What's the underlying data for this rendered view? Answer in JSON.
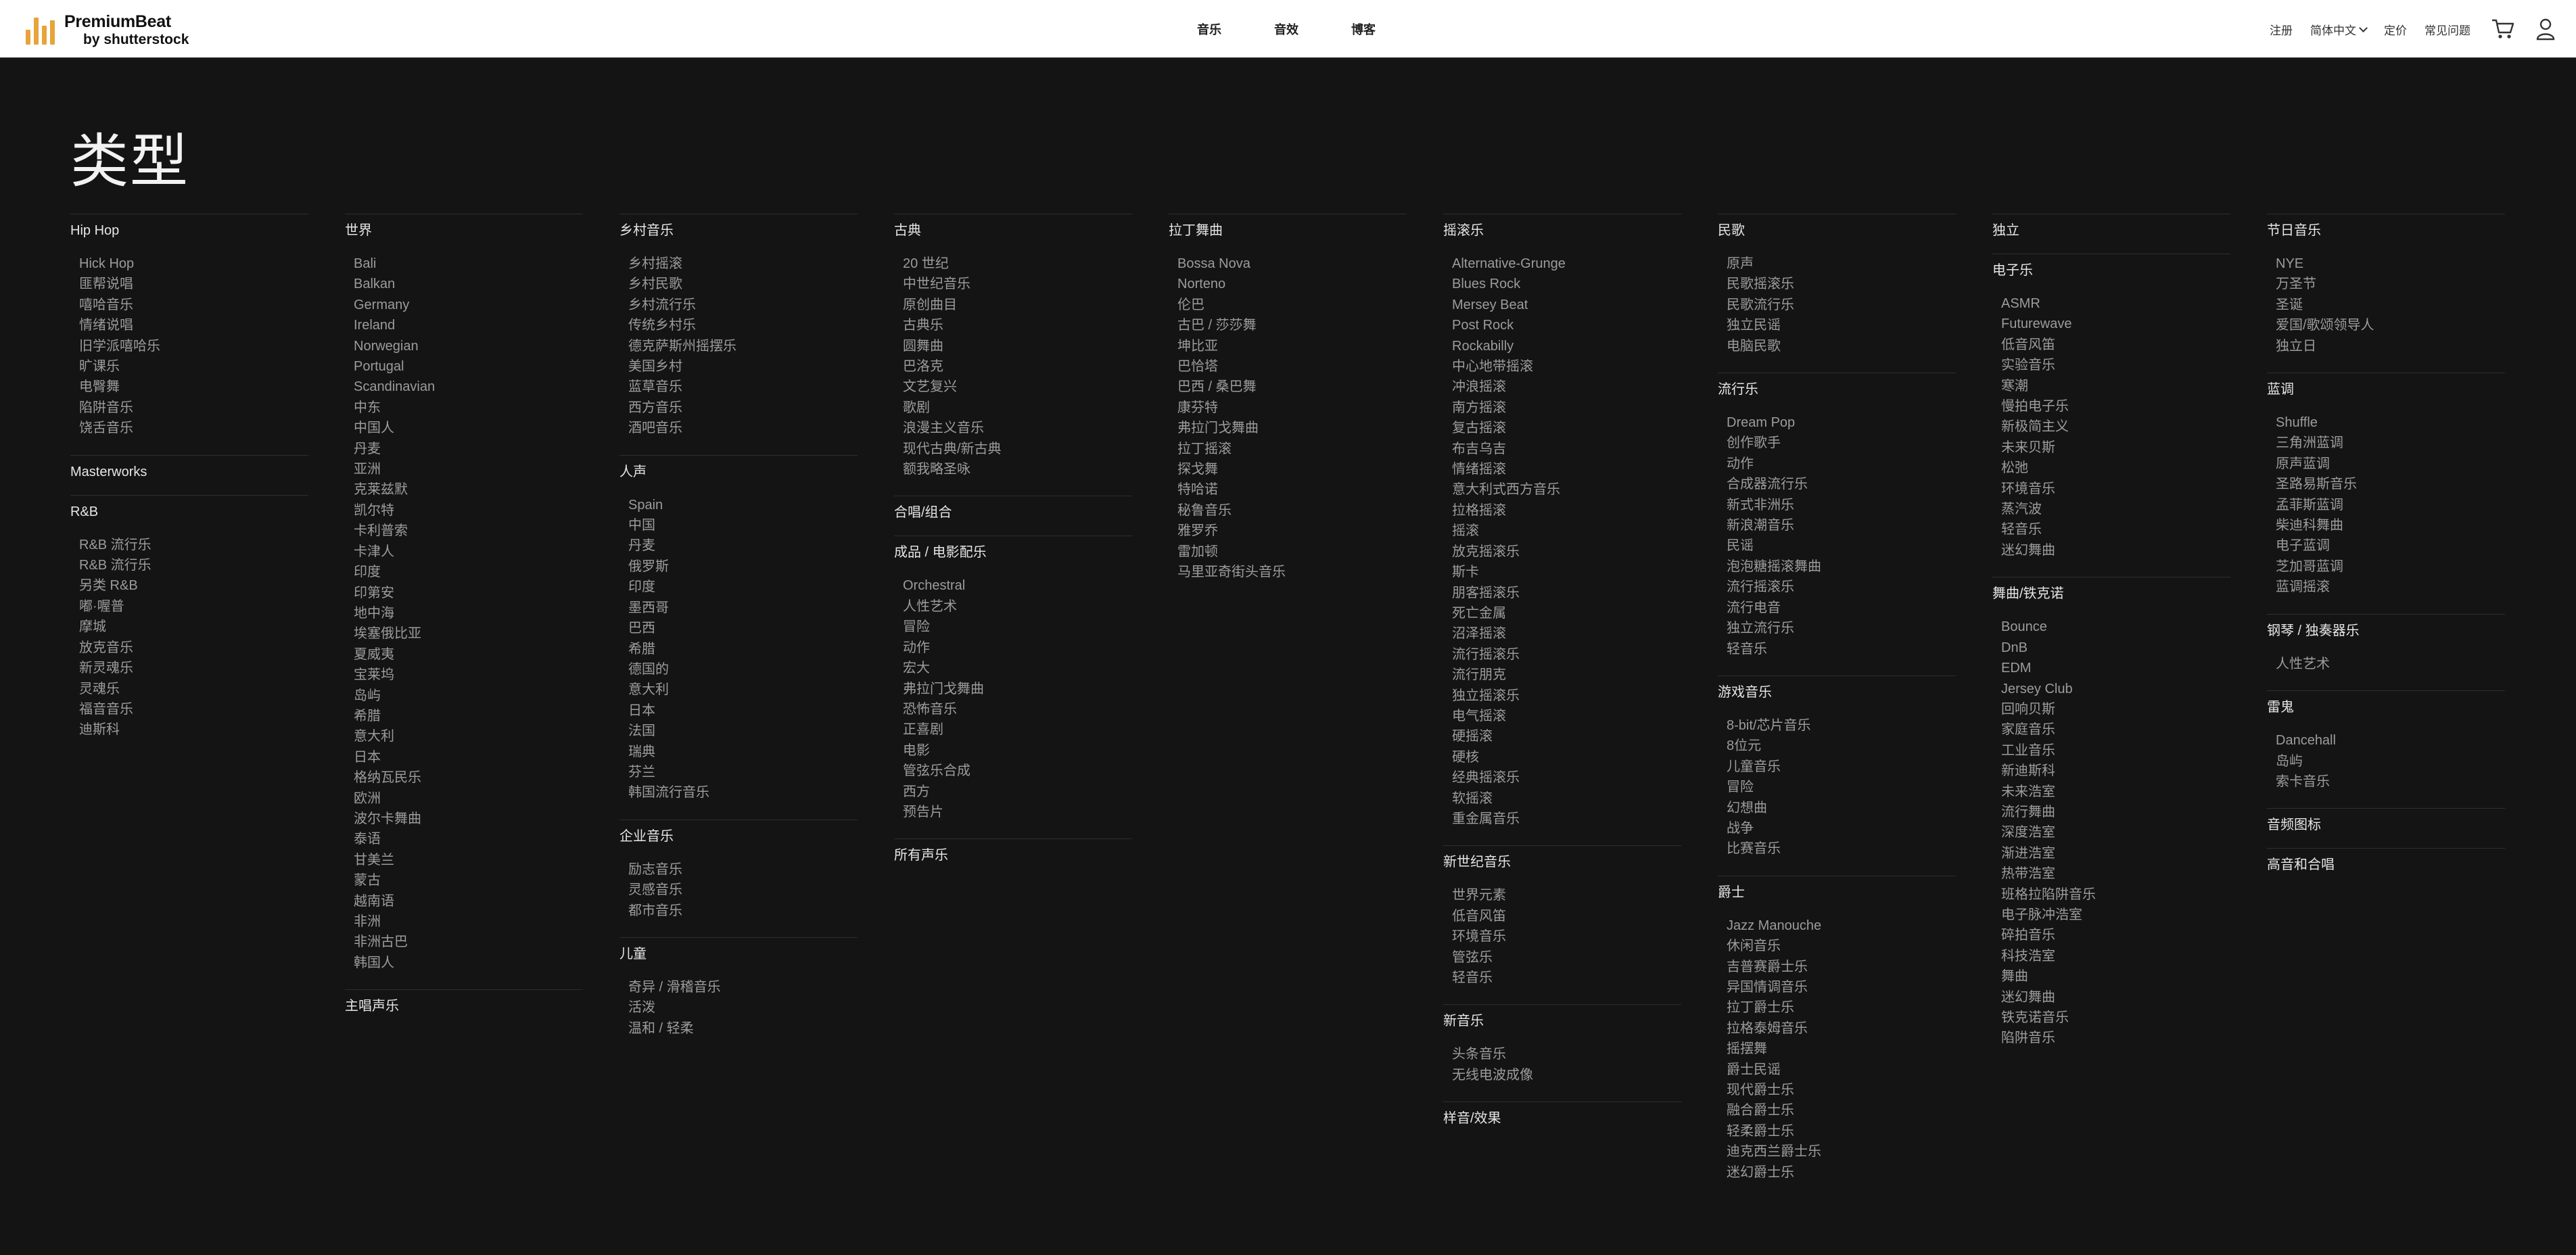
{
  "header": {
    "logo_name": "PremiumBeat",
    "logo_sub": "by shutterstock",
    "nav": [
      "音乐",
      "音效",
      "博客"
    ],
    "right_links": {
      "register": "注册",
      "language": "简体中文",
      "pricing": "定价",
      "faq": "常见问题"
    },
    "icons": {
      "cart": "cart-icon",
      "account": "user-icon",
      "language": "chevron-down-icon"
    },
    "logo_color": "#e8a33a"
  },
  "page": {
    "title": "类型"
  },
  "columns": [
    [
      {
        "title": "Hip Hop",
        "items": [
          "Hick Hop",
          "匪帮说唱",
          "嘻哈音乐",
          "情绪说唱",
          "旧学派嘻哈乐",
          "旷课乐",
          "电臀舞",
          "陷阱音乐",
          "饶舌音乐"
        ]
      },
      {
        "title": "Masterworks",
        "items": []
      },
      {
        "title": "R&B",
        "items": [
          "R&B 流行乐",
          "R&B 流行乐",
          "另类 R&B",
          "嘟·喔普",
          "摩城",
          "放克音乐",
          "新灵魂乐",
          "灵魂乐",
          "福音音乐",
          "迪斯科"
        ]
      }
    ],
    [
      {
        "title": "世界",
        "items": [
          "Bali",
          "Balkan",
          "Germany",
          "Ireland",
          "Norwegian",
          "Portugal",
          "Scandinavian",
          "中东",
          "中国人",
          "丹麦",
          "亚洲",
          "克莱兹默",
          "凯尔特",
          "卡利普索",
          "卡津人",
          "印度",
          "印第安",
          "地中海",
          "埃塞俄比亚",
          "夏威夷",
          "宝莱坞",
          "岛屿",
          "希腊",
          "意大利",
          "日本",
          "格纳瓦民乐",
          "欧洲",
          "波尔卡舞曲",
          "泰语",
          "甘美兰",
          "蒙古",
          "越南语",
          "非洲",
          "非洲古巴",
          "韩国人"
        ]
      },
      {
        "title": "主唱声乐",
        "items": []
      }
    ],
    [
      {
        "title": "乡村音乐",
        "items": [
          "乡村摇滚",
          "乡村民歌",
          "乡村流行乐",
          "传统乡村乐",
          "德克萨斯州摇摆乐",
          "美国乡村",
          "蓝草音乐",
          "西方音乐",
          "酒吧音乐"
        ]
      },
      {
        "title": "人声",
        "items": [
          "Spain",
          "中国",
          "丹麦",
          "俄罗斯",
          "印度",
          "墨西哥",
          "巴西",
          "希腊",
          "德国的",
          "意大利",
          "日本",
          "法国",
          "瑞典",
          "芬兰",
          "韩国流行音乐"
        ]
      },
      {
        "title": "企业音乐",
        "items": [
          "励志音乐",
          "灵感音乐",
          "都市音乐"
        ]
      },
      {
        "title": "儿童",
        "items": [
          "奇异 / 滑稽音乐",
          "活泼",
          "温和 / 轻柔"
        ]
      }
    ],
    [
      {
        "title": "古典",
        "items": [
          "20 世纪",
          "中世纪音乐",
          "原创曲目",
          "古典乐",
          "圆舞曲",
          "巴洛克",
          "文艺复兴",
          "歌剧",
          "浪漫主义音乐",
          "现代古典/新古典",
          "额我略圣咏"
        ]
      },
      {
        "title": "合唱/组合",
        "items": []
      },
      {
        "title": "成品 / 电影配乐",
        "items": [
          "Orchestral",
          "人性艺术",
          "冒险",
          "动作",
          "宏大",
          "弗拉门戈舞曲",
          "恐怖音乐",
          "正喜剧",
          "电影",
          "管弦乐合成",
          "西方",
          "预告片"
        ]
      },
      {
        "title": "所有声乐",
        "items": []
      }
    ],
    [
      {
        "title": "拉丁舞曲",
        "items": [
          "Bossa Nova",
          "Norteno",
          "伦巴",
          "古巴 / 莎莎舞",
          "坤比亚",
          "巴恰塔",
          "巴西 / 桑巴舞",
          "康芬特",
          "弗拉门戈舞曲",
          "拉丁摇滚",
          "探戈舞",
          "特哈诺",
          "秘鲁音乐",
          "雅罗乔",
          "雷加顿",
          "马里亚奇街头音乐"
        ]
      }
    ],
    [
      {
        "title": "摇滚乐",
        "items": [
          "Alternative-Grunge",
          "Blues Rock",
          "Mersey Beat",
          "Post Rock",
          "Rockabilly",
          "中心地带摇滚",
          "冲浪摇滚",
          "南方摇滚",
          "复古摇滚",
          "布吉乌吉",
          "情绪摇滚",
          "意大利式西方音乐",
          "拉格摇滚",
          "摇滚",
          "放克摇滚乐",
          "斯卡",
          "朋客摇滚乐",
          "死亡金属",
          "沼泽摇滚",
          "流行摇滚乐",
          "流行朋克",
          "独立摇滚乐",
          "电气摇滚",
          "硬摇滚",
          "硬核",
          "经典摇滚乐",
          "软摇滚",
          "重金属音乐"
        ]
      },
      {
        "title": "新世纪音乐",
        "items": [
          "世界元素",
          "低音风笛",
          "环境音乐",
          "管弦乐",
          "轻音乐"
        ]
      },
      {
        "title": "新音乐",
        "items": [
          "头条音乐",
          "无线电波成像"
        ]
      },
      {
        "title": "样音/效果",
        "items": []
      }
    ],
    [
      {
        "title": "民歌",
        "items": [
          "原声",
          "民歌摇滚乐",
          "民歌流行乐",
          "独立民谣",
          "电脑民歌"
        ]
      },
      {
        "title": "流行乐",
        "items": [
          "Dream Pop",
          "创作歌手",
          "动作",
          "合成器流行乐",
          "新式非洲乐",
          "新浪潮音乐",
          "民谣",
          "泡泡糖摇滚舞曲",
          "流行摇滚乐",
          "流行电音",
          "独立流行乐",
          "轻音乐"
        ]
      },
      {
        "title": "游戏音乐",
        "items": [
          "8-bit/芯片音乐",
          "8位元",
          "儿童音乐",
          "冒险",
          "幻想曲",
          "战争",
          "比赛音乐"
        ]
      },
      {
        "title": "爵士",
        "items": [
          "Jazz Manouche",
          "休闲音乐",
          "吉普赛爵士乐",
          "异国情调音乐",
          "拉丁爵士乐",
          "拉格泰姆音乐",
          "摇摆舞",
          "爵士民谣",
          "现代爵士乐",
          "融合爵士乐",
          "轻柔爵士乐",
          "迪克西兰爵士乐",
          "迷幻爵士乐"
        ]
      }
    ],
    [
      {
        "title": "独立",
        "items": []
      },
      {
        "title": "电子乐",
        "items": [
          "ASMR",
          "Futurewave",
          "低音风笛",
          "实验音乐",
          "寒潮",
          "慢拍电子乐",
          "新极简主义",
          "未来贝斯",
          "松弛",
          "环境音乐",
          "蒸汽波",
          "轻音乐",
          "迷幻舞曲"
        ]
      },
      {
        "title": "舞曲/铁克诺",
        "items": [
          "Bounce",
          "DnB",
          "EDM",
          "Jersey Club",
          "回响贝斯",
          "家庭音乐",
          "工业音乐",
          "新迪斯科",
          "未来浩室",
          "流行舞曲",
          "深度浩室",
          "渐进浩室",
          "热带浩室",
          "班格拉陷阱音乐",
          "电子脉冲浩室",
          "碎拍音乐",
          "科技浩室",
          "舞曲",
          "迷幻舞曲",
          "铁克诺音乐",
          "陷阱音乐"
        ]
      }
    ],
    [
      {
        "title": "节日音乐",
        "items": [
          "NYE",
          "万圣节",
          "圣诞",
          "爱国/歌颂领导人",
          "独立日"
        ]
      },
      {
        "title": "蓝调",
        "items": [
          "Shuffle",
          "三角洲蓝调",
          "原声蓝调",
          "圣路易斯音乐",
          "孟菲斯蓝调",
          "柴迪科舞曲",
          "电子蓝调",
          "芝加哥蓝调",
          "蓝调摇滚"
        ]
      },
      {
        "title": "钢琴 / 独奏器乐",
        "items": [
          "人性艺术"
        ]
      },
      {
        "title": "雷鬼",
        "items": [
          "Dancehall",
          "岛屿",
          "索卡音乐"
        ]
      },
      {
        "title": "音频图标",
        "items": []
      },
      {
        "title": "高音和合唱",
        "items": []
      }
    ]
  ]
}
